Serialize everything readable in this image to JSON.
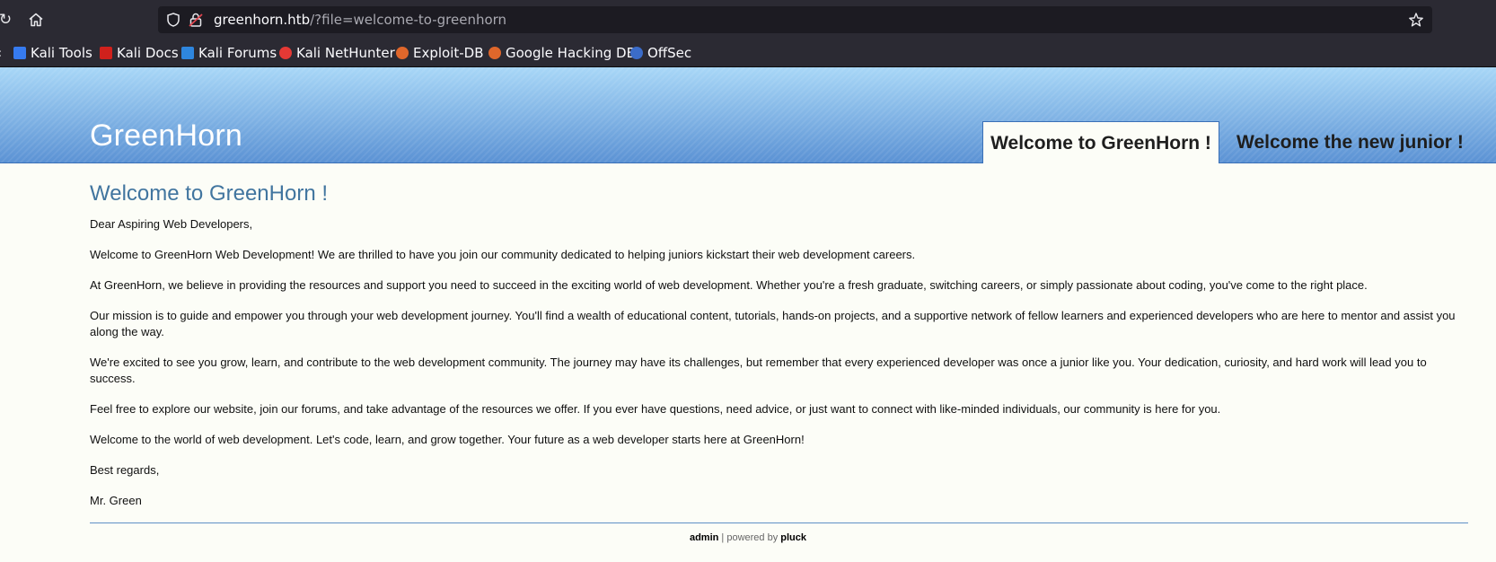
{
  "browser": {
    "url_host": "greenhorn.htb",
    "url_path": "/?file=welcome-to-greenhorn",
    "bookmarks": [
      {
        "label": "Kali Tools",
        "icon": "kali-tools-icon",
        "color": "#367bf0"
      },
      {
        "label": "Kali Docs",
        "icon": "kali-docs-icon",
        "color": "#d0211c"
      },
      {
        "label": "Kali Forums",
        "icon": "kali-forums-icon",
        "color": "#2e86de"
      },
      {
        "label": "Kali NetHunter",
        "icon": "kali-nethunter-icon",
        "color": "#e53935"
      },
      {
        "label": "Exploit-DB",
        "icon": "exploit-db-icon",
        "color": "#e0672b"
      },
      {
        "label": "Google Hacking DB",
        "icon": "google-hacking-db-icon",
        "color": "#e0672b"
      },
      {
        "label": "OffSec",
        "icon": "offsec-icon",
        "color": "#3b6cc9"
      }
    ]
  },
  "site": {
    "title": "GreenHorn",
    "tabs": [
      {
        "label": "Welcome to GreenHorn !",
        "active": true
      },
      {
        "label": "Welcome the new junior !",
        "active": false
      }
    ]
  },
  "content": {
    "heading": "Welcome to GreenHorn !",
    "paragraphs": [
      "Dear Aspiring Web Developers,",
      "Welcome to GreenHorn Web Development! We are thrilled to have you join our community dedicated to helping juniors kickstart their web development careers.",
      "At GreenHorn, we believe in providing the resources and support you need to succeed in the exciting world of web development. Whether you're a fresh graduate, switching careers, or simply passionate about coding, you've come to the right place.",
      "Our mission is to guide and empower you through your web development journey. You'll find a wealth of educational content, tutorials, hands-on projects, and a supportive network of fellow learners and experienced developers who are here to mentor and assist you along the way.",
      "We're excited to see you grow, learn, and contribute to the web development community. The journey may have its challenges, but remember that every experienced developer was once a junior like you. Your dedication, curiosity, and hard work will lead you to success.",
      "Feel free to explore our website, join our forums, and take advantage of the resources we offer. If you ever have questions, need advice, or just want to connect with like-minded individuals, our community is here for you.",
      "Welcome to the world of web development. Let's code, learn, and grow together. Your future as a web developer starts here at GreenHorn!",
      "Best regards,",
      "Mr. Green"
    ]
  },
  "footer": {
    "admin_label": "admin",
    "separator": " | powered by ",
    "pluck_label": "pluck"
  }
}
